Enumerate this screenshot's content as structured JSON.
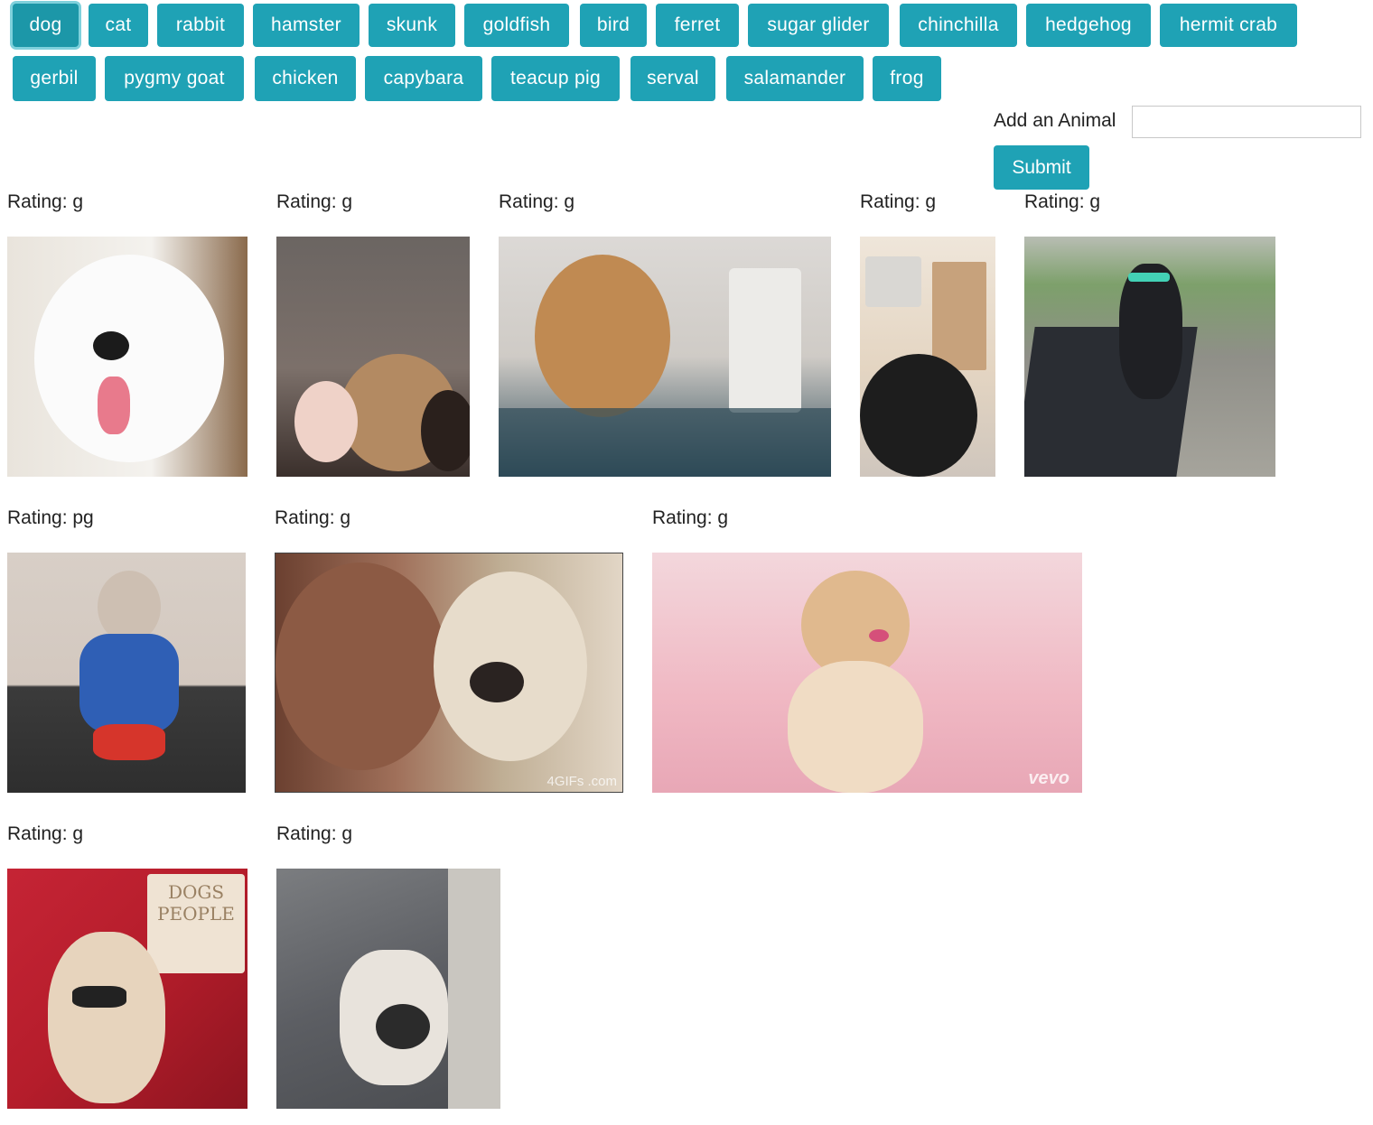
{
  "animals": [
    "dog",
    "cat",
    "rabbit",
    "hamster",
    "skunk",
    "goldfish",
    "bird",
    "ferret",
    "sugar glider",
    "chinchilla",
    "hedgehog",
    "hermit crab",
    "gerbil",
    "pygmy goat",
    "chicken",
    "capybara",
    "teacup pig",
    "serval",
    "salamander",
    "frog"
  ],
  "active_animal": "dog",
  "form": {
    "label": "Add an Animal",
    "input_value": "",
    "submit_label": "Submit"
  },
  "gifs": [
    {
      "rating": "Rating: g",
      "subject": "white samoyed smiling",
      "colors": [
        "#e9e4dc",
        "#ffffff",
        "#8a6a4c"
      ]
    },
    {
      "rating": "Rating: g",
      "subject": "dog on couch with woman",
      "colors": [
        "#6b6562",
        "#b38a62",
        "#efd2c8"
      ]
    },
    {
      "rating": "Rating: g",
      "subject": "shiba on laptop in bed",
      "colors": [
        "#d9d6d3",
        "#c08a52",
        "#2e4a57"
      ]
    },
    {
      "rating": "Rating: g",
      "subject": "black dog by tv",
      "colors": [
        "#efe6da",
        "#1d1d1d",
        "#c7a27c"
      ]
    },
    {
      "rating": "Rating: g",
      "subject": "dog with sunglasses on swing",
      "colors": [
        "#8f8f88",
        "#2a2d33",
        "#7da06b"
      ]
    },
    {
      "rating": "Rating: pg",
      "subject": "chihuahua superman treadmill",
      "colors": [
        "#d8cfc7",
        "#2f5fb5",
        "#3b3b3b"
      ]
    },
    {
      "rating": "Rating: g",
      "subject": "two dogs close up",
      "colors": [
        "#a0705a",
        "#e2d6c6",
        "#6b4030"
      ],
      "watermark": "4GIFs .com"
    },
    {
      "rating": "Rating: g",
      "subject": "pomeranian pink background",
      "colors": [
        "#f0b8c3",
        "#e0b98e",
        "#f3d7dc"
      ],
      "watermark": "vevo"
    },
    {
      "rating": "Rating: g",
      "subject": "pug with bow tie",
      "colors": [
        "#b51d2b",
        "#e7d4bd",
        "#d4a868"
      ],
      "book_title": "DOGS PEOPLE"
    },
    {
      "rating": "Rating: g",
      "subject": "dog in raincoat on wet street",
      "colors": [
        "#5c5e63",
        "#e8e3dc",
        "#2b2b2b"
      ]
    }
  ]
}
